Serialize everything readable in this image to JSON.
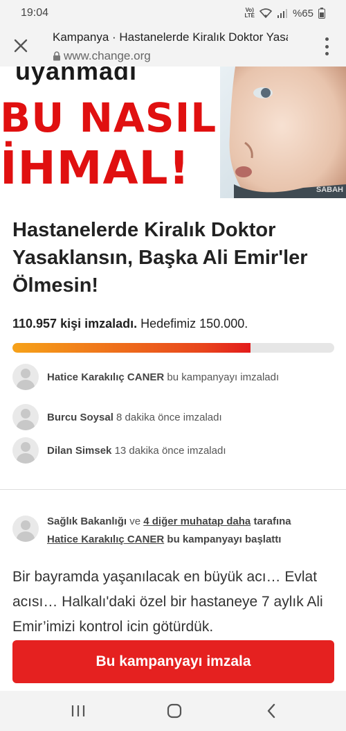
{
  "status_bar": {
    "time": "19:04",
    "volte": "Vo)) LTE",
    "battery": "%65"
  },
  "browser": {
    "title": "Kampanya · Hastanelerde Kiralık Doktor Yasaklansın",
    "url": "www.change.org"
  },
  "hero": {
    "small_text": "uyanmadı",
    "line1": "BU NASIL",
    "line2": "İHMAL!",
    "watermark": "SABAH"
  },
  "petition": {
    "title": "Hastanelerde Kiralık Doktor Yasaklansın, Başka Ali Emir'ler Ölmesin!",
    "signed_count": "110.957 kişi imzaladı.",
    "goal": "Hedefimiz 150.000.",
    "progress_fraction": 0.7395
  },
  "signers": [
    {
      "name": "Hatice Karakılıç CANER",
      "action": "bu kampanyayı imzaladı"
    },
    {
      "name": "Burcu Soysal",
      "action": "8 dakika önce imzaladı"
    },
    {
      "name": "Dilan Simsek",
      "action": "13 dakika önce imzaladı"
    }
  ],
  "starter": {
    "target": "Sağlık Bakanlığı",
    "conj": "ve",
    "others_link": "4 diğer muhatap daha",
    "by": "tarafına",
    "starter_name": "Hatice Karakılıç CANER",
    "action": "bu kampanyayı başlattı"
  },
  "body": {
    "text": "Bir bayramda yaşanılacak en büyük acı… Evlat acısı… Halkalı'daki özel bir hastaneye 7 aylık Ali Emir’imizi kontrol icin götürdük."
  },
  "cta": {
    "label": "Bu kampanyayı imzala",
    "color": "#e52120"
  },
  "colors": {
    "accent": "#e52120",
    "progress_start": "#f6a21a",
    "progress_end": "#e31b1b"
  }
}
